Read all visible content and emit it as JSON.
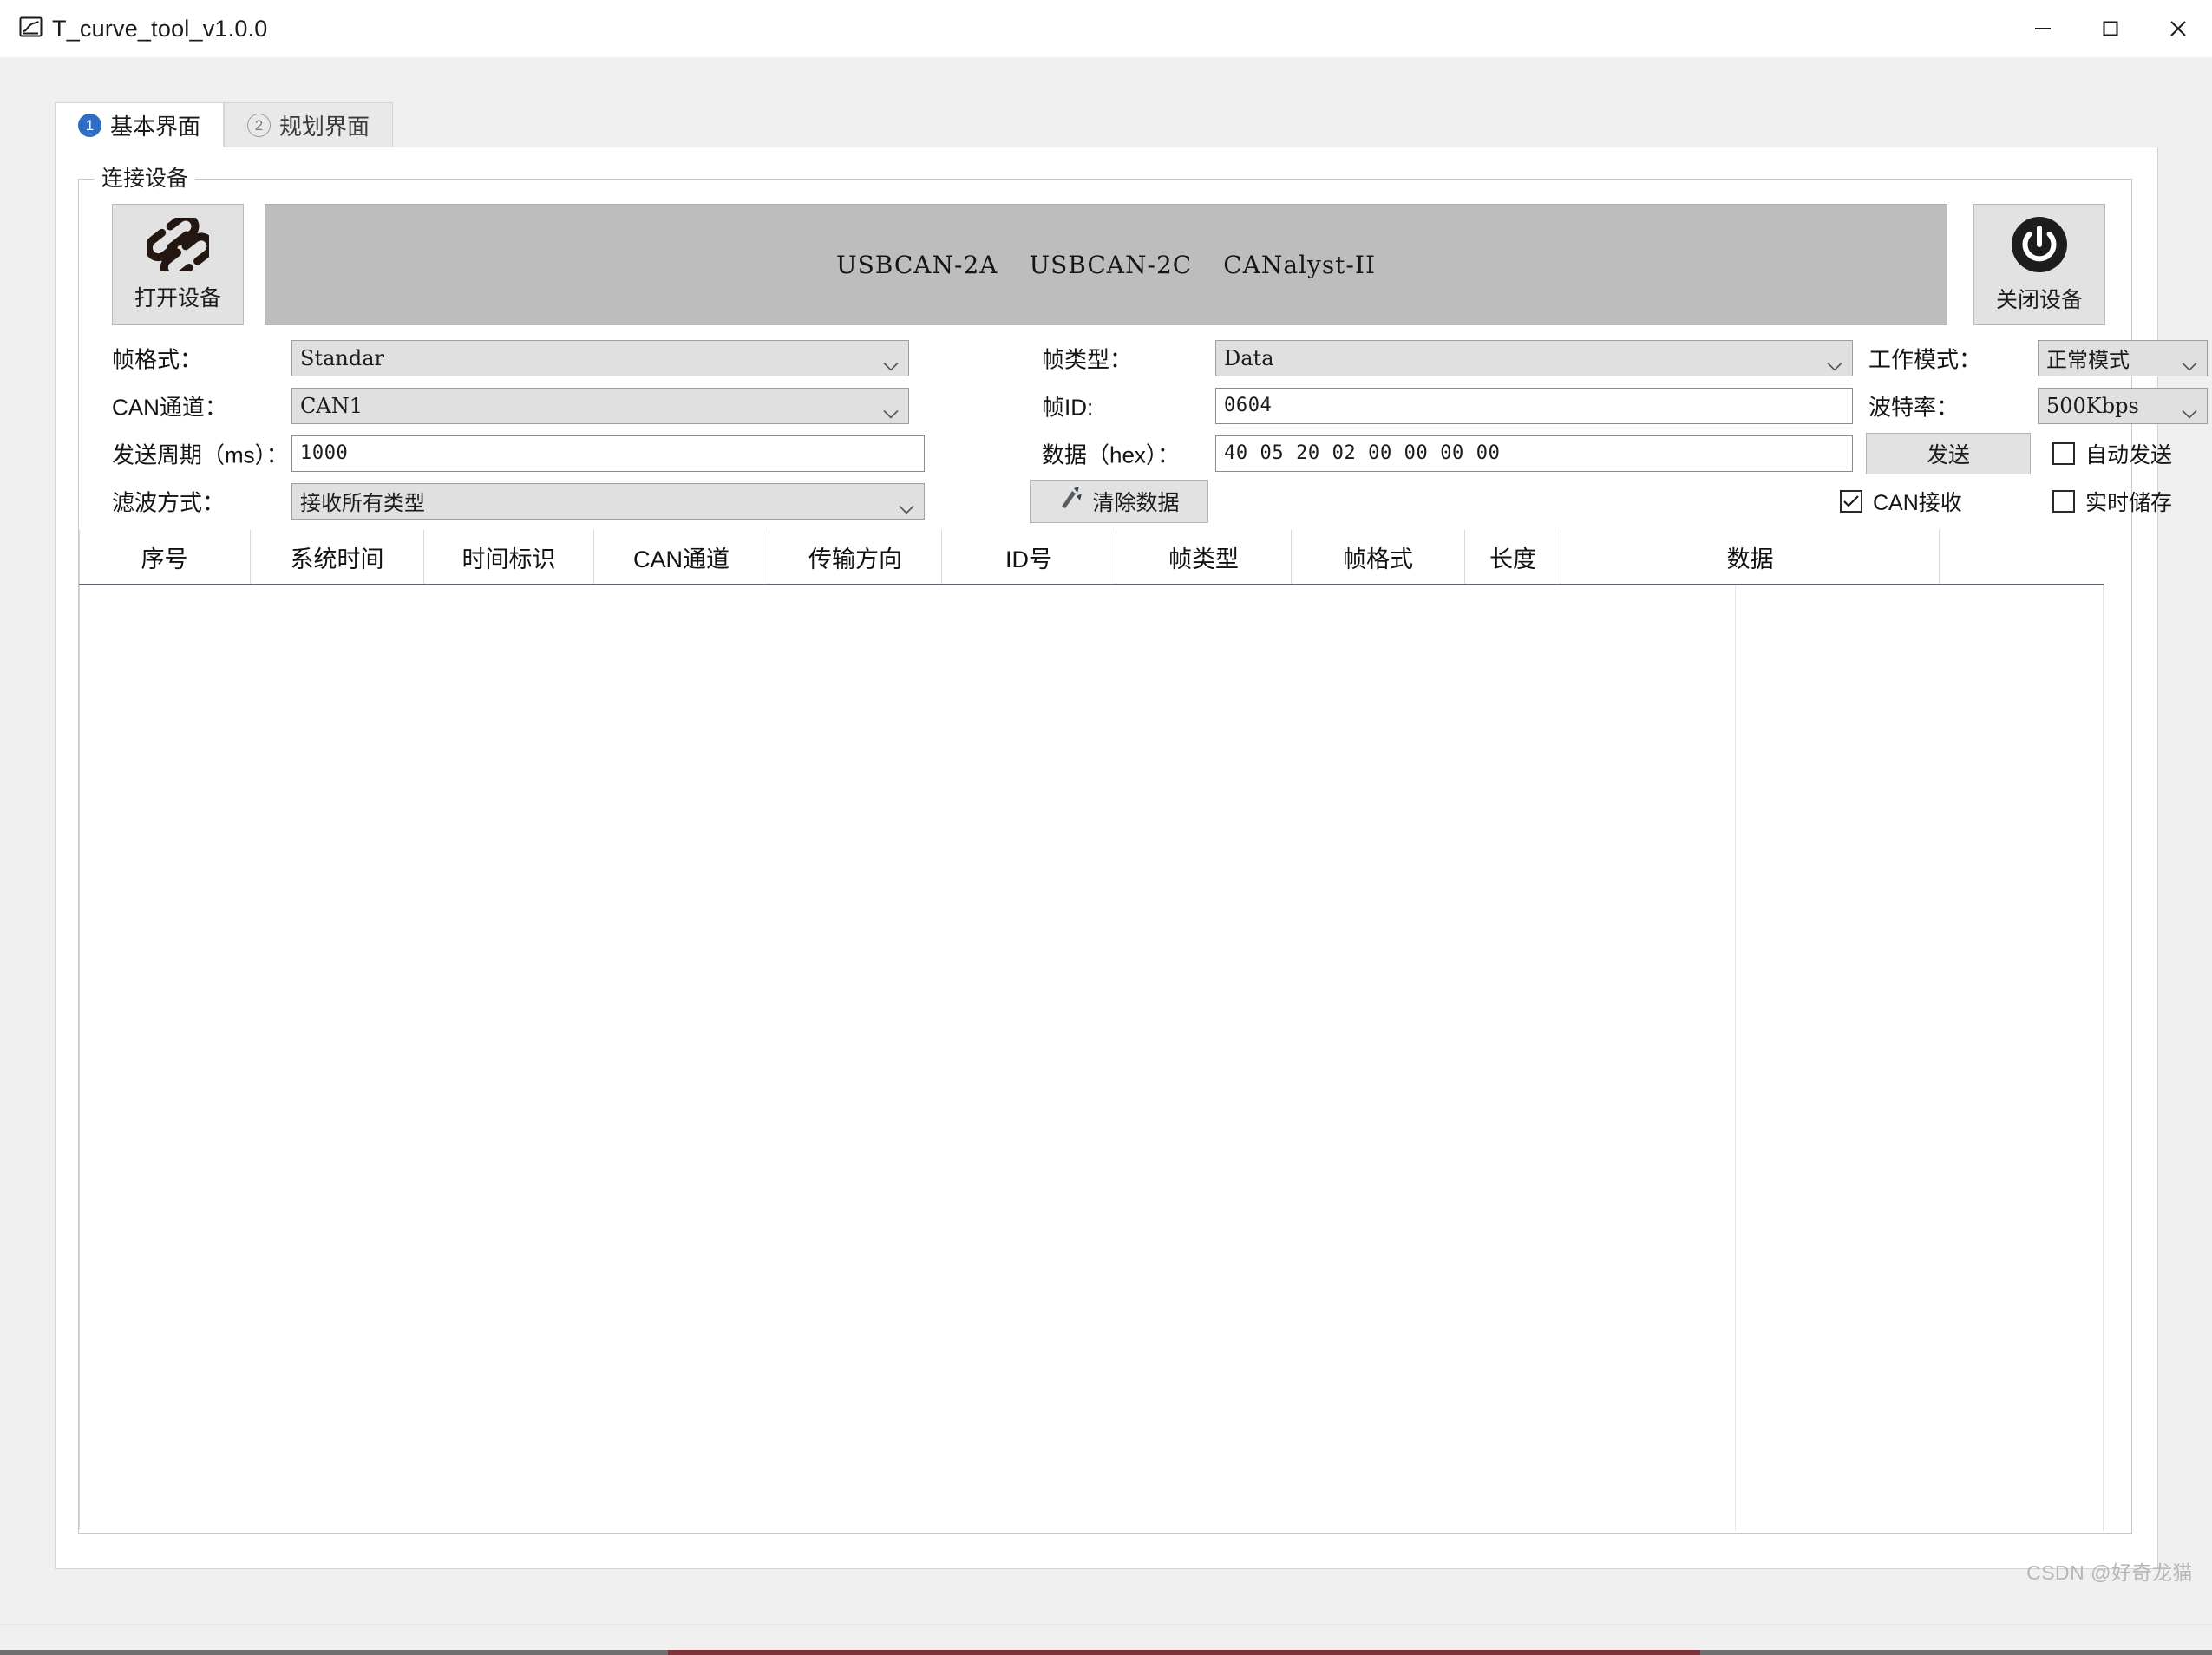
{
  "window": {
    "title": "T_curve_tool_v1.0.0",
    "app_icon": "chart-curve-icon",
    "minimize": "minimize-icon",
    "maximize": "maximize-icon",
    "close": "close-icon"
  },
  "tabs": [
    {
      "badge": "1",
      "label": "基本界面",
      "active": true
    },
    {
      "badge": "2",
      "label": "规划界面",
      "active": false
    }
  ],
  "group": {
    "title": "连接设备"
  },
  "device": {
    "open_button": {
      "label": "打开设备",
      "icon": "link-chain-icon"
    },
    "close_button": {
      "label": "关闭设备",
      "icon": "power-icon"
    },
    "banner_items": [
      "USBCAN-2A",
      "USBCAN-2C",
      "CANalyst-II"
    ]
  },
  "form": {
    "frame_format": {
      "label": "帧格式：",
      "value": "Standar"
    },
    "frame_type": {
      "label": "帧类型：",
      "value": "Data"
    },
    "work_mode": {
      "label": "工作模式：",
      "value": "正常模式"
    },
    "can_channel": {
      "label": "CAN通道：",
      "value": "CAN1"
    },
    "frame_id": {
      "label": "帧ID:",
      "value": "0604"
    },
    "baud_rate": {
      "label": "波特率：",
      "value": "500Kbps"
    },
    "send_period": {
      "label": "发送周期（ms）：",
      "value": "1000"
    },
    "data_hex": {
      "label": "数据（hex）：",
      "value": "40 05 20 02 00 00 00 00"
    },
    "send_button": {
      "label": "发送"
    },
    "auto_send": {
      "label": "自动发送",
      "checked": false
    },
    "filter_mode": {
      "label": "滤波方式：",
      "value": "接收所有类型"
    },
    "clear_button": {
      "label": "清除数据",
      "icon": "broom-icon"
    },
    "can_receive": {
      "label": "CAN接收",
      "checked": true
    },
    "realtime_save": {
      "label": "实时储存",
      "checked": false
    }
  },
  "table": {
    "headers": [
      "序号",
      "系统时间",
      "时间标识",
      "CAN通道",
      "传输方向",
      "ID号",
      "帧类型",
      "帧格式",
      "长度",
      "数据"
    ],
    "rows": []
  },
  "watermark": "CSDN @好奇龙猫",
  "colors": {
    "accent": "#2f6ec4",
    "panel_bg": "#ffffff",
    "window_bg": "#f0f0f0",
    "banner_bg": "#bdbdbd",
    "button_bg": "#e2e2e2",
    "header_rule": "#5a6472"
  }
}
